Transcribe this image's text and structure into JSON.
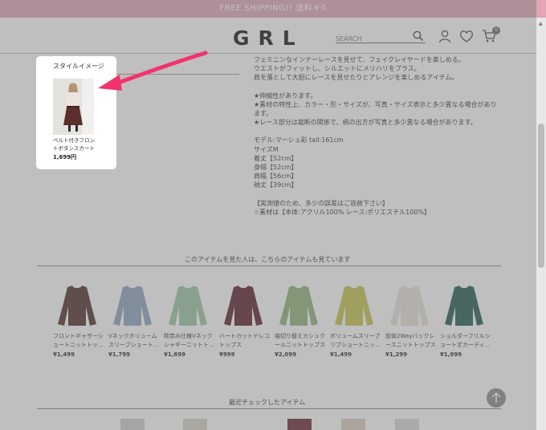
{
  "banner": {
    "text": "FREE SHIPPING!! 送料￥0"
  },
  "header": {
    "logo": "GRL",
    "search_placeholder": "SEARCH",
    "cart_count": "0",
    "icons": [
      "search-icon",
      "account-icon",
      "heart-icon",
      "cart-icon"
    ]
  },
  "description": {
    "lines": [
      "フェミニンなインナーレースを見せて、フェイクレイヤードを楽しめる。",
      "ウエストがフィットし、シルエットにメリハリをプラス。",
      "肩を落として大胆にレースを見せたりとアレンジを楽しめるアイテム。",
      "",
      "★伸縮性があります。",
      "★素材の特性上、カラー・形・サイズが、写真・サイズ表示と多少異なる場合があり",
      "ます。",
      "★レース部分は裁断の関係で、柄の出方が写真と多少異なる場合があります。",
      "",
      "モデル:マーシュ彩 tall:161cm",
      "サイズM",
      "着丈【52cm】",
      "身幅【52cm】",
      "肩幅【56cm】",
      "袖丈【39cm】",
      "",
      "【実測値のため、多少の誤差はご容赦下さい】",
      "☆素材は【本体:アクリル100% レース:ポリエステル100%】"
    ]
  },
  "style_popup": {
    "title": "スタイルイメージ",
    "product_name_line1": "ベルト付きフロン",
    "product_name_line2": "トボタンスカート",
    "price": "1,699円"
  },
  "related": {
    "title": "このアイテムを見た人は、こちらのアイテムも見ています",
    "items": [
      {
        "name1": "フロントギャザーシ",
        "name2": "ョートニットトッ…",
        "price": "¥1,499",
        "color": "#4a2a24"
      },
      {
        "name1": "Vネックボリューム",
        "name2": "スリーブショート…",
        "price": "¥1,799",
        "color": "#8ea3bf"
      },
      {
        "name1": "畦奈み仕様Vネック",
        "name2": "シャギーニットト…",
        "price": "¥1,699",
        "color": "#9cc4a3"
      },
      {
        "name1": "ハートカットテレコ",
        "name2": "トップス",
        "price": "¥999",
        "color": "#5a1a26"
      },
      {
        "name1": "袖切り替えカシュク",
        "name2": "ールニットトップス",
        "price": "¥2,099",
        "color": "#8fb27a"
      },
      {
        "name1": "ボリュームスリーブ",
        "name2": "リブショートニッ…",
        "price": "¥1,499",
        "color": "#c7c24a"
      },
      {
        "name1": "前後2Wayバックレ",
        "name2": "ースニットトップス",
        "price": "¥1,299",
        "color": "#e8e0d8"
      },
      {
        "name1": "ショルダーフリルシ",
        "name2": "ョート丈カーディ…",
        "price": "¥1,999",
        "color": "#1e5a4c"
      }
    ]
  },
  "recent": {
    "title": "最近チェックしたアイテム"
  }
}
